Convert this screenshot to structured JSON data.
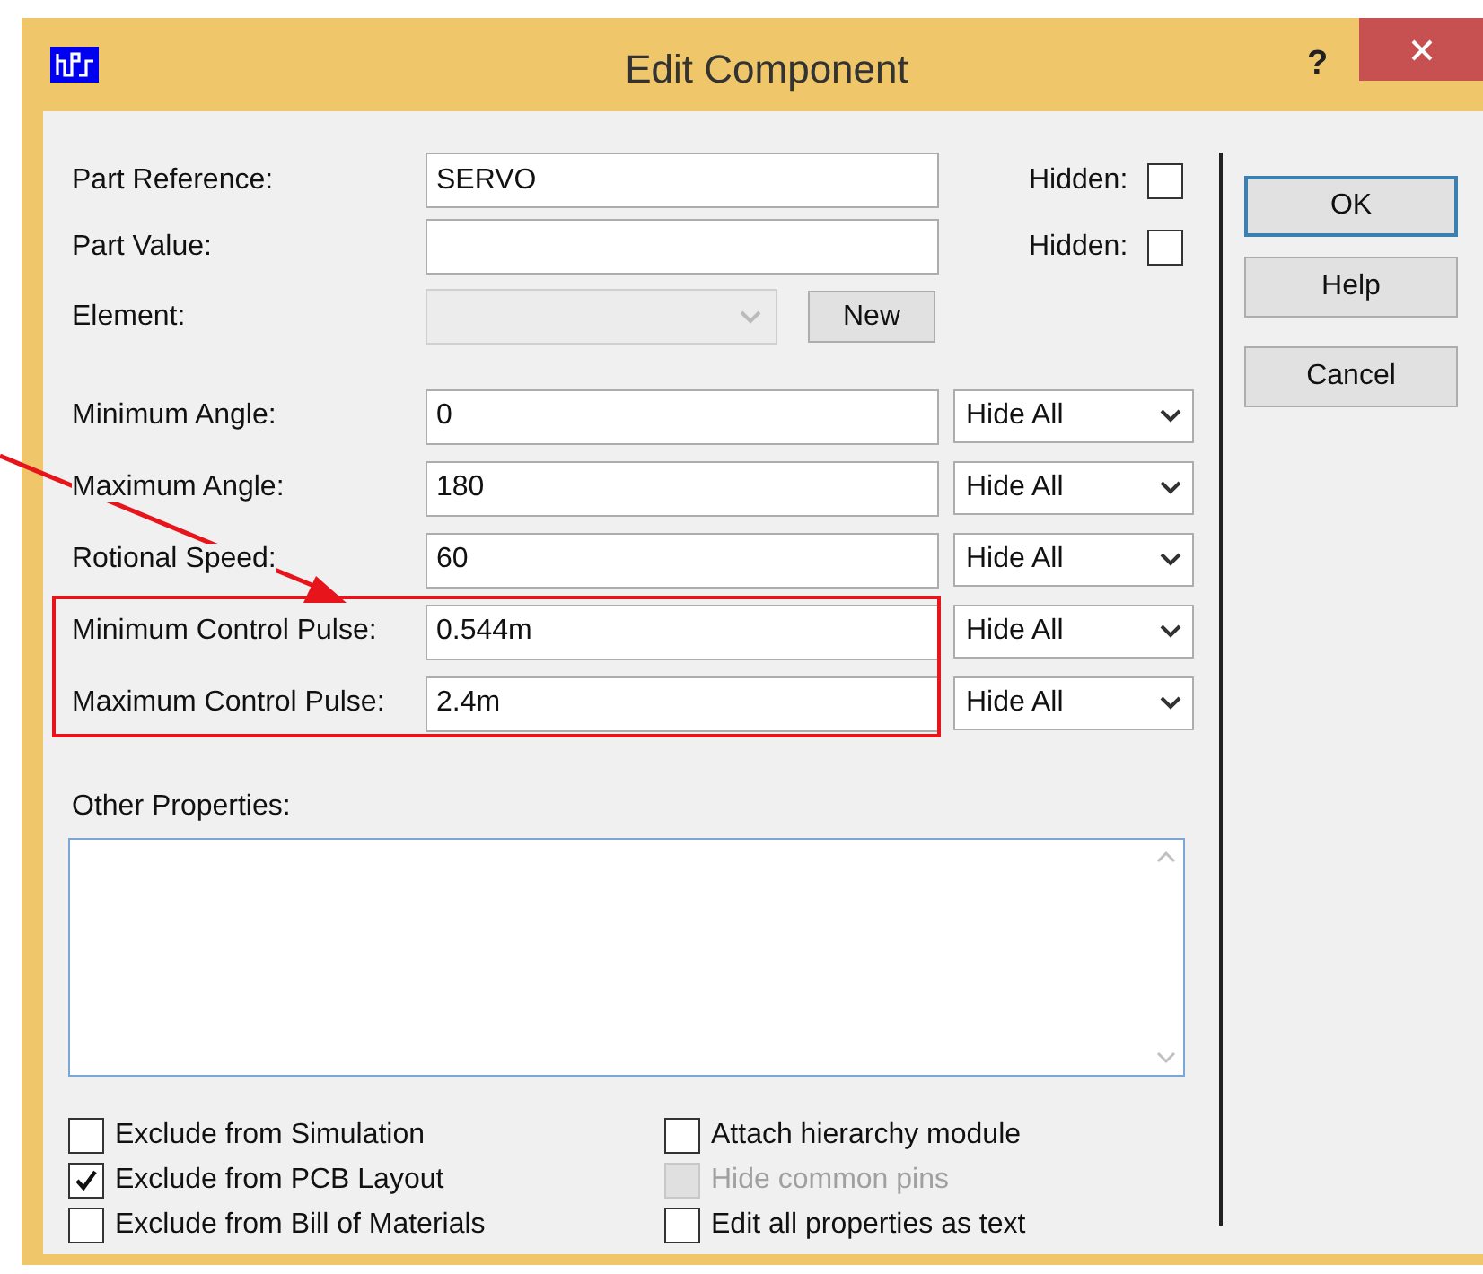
{
  "window": {
    "title": "Edit Component",
    "help_glyph": "?"
  },
  "part_reference": {
    "label": "Part Reference:",
    "value": "SERVO",
    "hidden_label": "Hidden:",
    "hidden": false
  },
  "part_value": {
    "label": "Part Value:",
    "hidden_label": "Hidden:",
    "hidden": false
  },
  "element": {
    "label": "Element:",
    "disabled": true,
    "new_button": {
      "label": "New"
    }
  },
  "properties": [
    {
      "label": "Minimum Angle:",
      "value": "0",
      "visibility": "Hide All",
      "highlighted": false
    },
    {
      "label": "Maximum Angle:",
      "value": "180",
      "visibility": "Hide All",
      "highlighted": false
    },
    {
      "label": "Rotional Speed:",
      "value": "60",
      "visibility": "Hide All",
      "highlighted": false
    },
    {
      "label": "Minimum Control Pulse:",
      "value": "0.544m",
      "visibility": "Hide All",
      "highlighted": true
    },
    {
      "label": "Maximum Control Pulse:",
      "value": "2.4m",
      "visibility": "Hide All",
      "highlighted": true
    }
  ],
  "other_properties": {
    "label": "Other Properties:"
  },
  "options_left": [
    {
      "label": "Exclude from Simulation",
      "checked": false,
      "disabled": false
    },
    {
      "label": "Exclude from PCB Layout",
      "checked": true,
      "disabled": false
    },
    {
      "label": "Exclude from Bill of Materials",
      "checked": false,
      "disabled": false
    }
  ],
  "options_right": [
    {
      "label": "Attach hierarchy module",
      "checked": false,
      "disabled": false
    },
    {
      "label": "Hide common pins",
      "checked": false,
      "disabled": true
    },
    {
      "label": "Edit all properties as text",
      "checked": false,
      "disabled": false
    }
  ],
  "buttons": [
    {
      "label": "OK",
      "default": true
    },
    {
      "label": "Help",
      "default": false
    },
    {
      "label": "Cancel",
      "default": false
    }
  ]
}
